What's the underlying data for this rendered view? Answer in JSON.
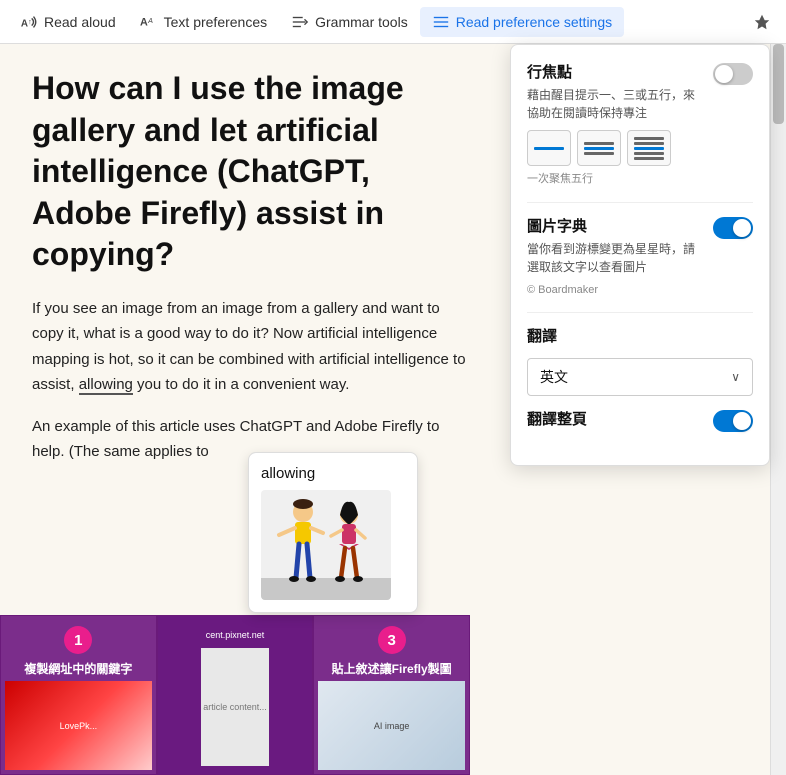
{
  "toolbar": {
    "read_aloud_label": "Read aloud",
    "text_preferences_label": "Text preferences",
    "grammar_tools_label": "Grammar tools",
    "read_preference_settings_label": "Read preference settings"
  },
  "article": {
    "heading": "How can I use the image gallery and let artificial intelligence (ChatGPT, Adobe Firefly) assist in copying?",
    "paragraph1": "If you see an image from an image from a gallery and want to copy it, what is a good way to do it? Now artificial intelligence mapping is hot, so it can be combined with artificial intelligence to assist, allowing you to do it in a convenient way.",
    "paragraph2": "An example of this article uses ChatGPT and Adobe Firefly to help. (The same applies to",
    "highlight_word": "allowing"
  },
  "word_tooltip": {
    "word": "allowing"
  },
  "settings_panel": {
    "focus_title": "行焦點",
    "focus_desc": "藉由醒目提示一、三或五行，來協助在閱讀時保持專注",
    "focus_sub": "一次聚焦五行",
    "focus_toggle": "off",
    "picture_dict_title": "圖片字典",
    "picture_dict_desc": "當你看到游標變更為星星時，請選取該文字以查看圖片",
    "picture_dict_copyright": "© Boardmaker",
    "picture_dict_toggle": "on",
    "translate_title": "翻譯",
    "translate_language": "英文",
    "translate_page_label": "翻譯整頁",
    "translate_page_toggle": "on"
  },
  "strip": {
    "item1_num": "1",
    "item1_label": "複製網址中的關鍵字",
    "item3_num": "3",
    "item3_label": "貼上敘述讓Firefly製圖",
    "middle_url": "cent.pixnet.net"
  },
  "icons": {
    "read_aloud": "A↑",
    "text_prefs": "A𝐴",
    "grammar": "≡→",
    "settings": "≡",
    "pin": "📌",
    "chevron_down": "∨"
  }
}
